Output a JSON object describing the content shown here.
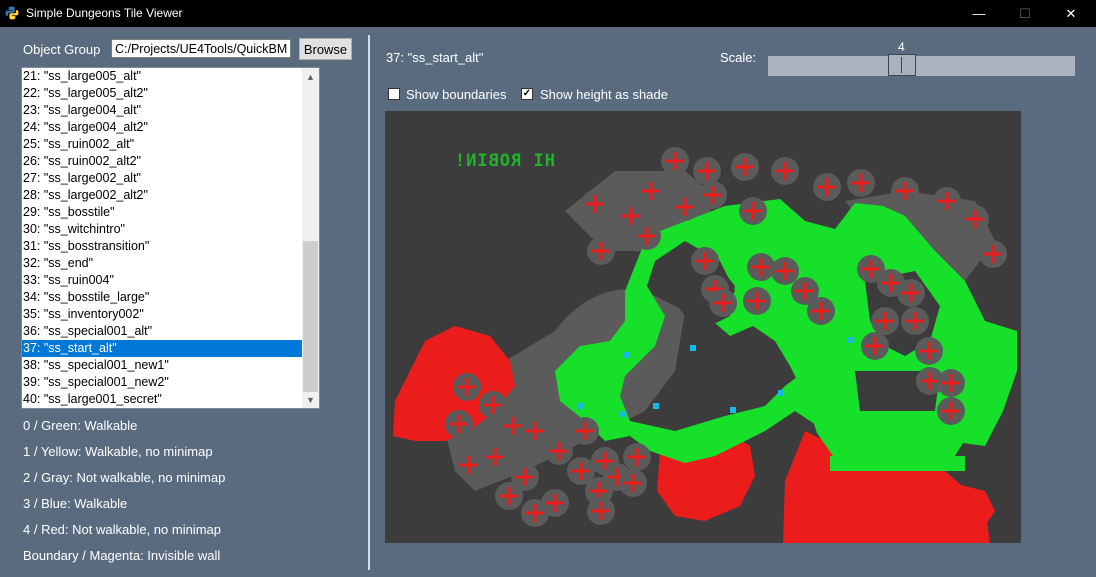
{
  "window": {
    "title": "Simple Dungeons Tile Viewer",
    "minimize_glyph": "—",
    "maximize_glyph": "☐",
    "close_glyph": "✕"
  },
  "object_group": {
    "label": "Object Group",
    "path_value": "C:/Projects/UE4Tools/QuickBMS",
    "browse_label": "Browse"
  },
  "tile_list": {
    "items": [
      "21: \"ss_large005_alt\"",
      "22: \"ss_large005_alt2\"",
      "23: \"ss_large004_alt\"",
      "24: \"ss_large004_alt2\"",
      "25: \"ss_ruin002_alt\"",
      "26: \"ss_ruin002_alt2\"",
      "27: \"ss_large002_alt\"",
      "28: \"ss_large002_alt2\"",
      "29: \"ss_bosstile\"",
      "30: \"ss_witchintro\"",
      "31: \"ss_bosstransition\"",
      "32: \"ss_end\"",
      "33: \"ss_ruin004\"",
      "34: \"ss_bosstile_large\"",
      "35: \"ss_inventory002\"",
      "36: \"ss_special001_alt\"",
      "37: \"ss_start_alt\"",
      "38: \"ss_special001_new1\"",
      "39: \"ss_special001_new2\"",
      "40: \"ss_large001_secret\""
    ],
    "selected_index": 16,
    "scroll_up_glyph": "▲",
    "scroll_down_glyph": "▼"
  },
  "legend": [
    "0 / Green: Walkable",
    "1 / Yellow: Walkable, no minimap",
    "2 / Gray: Not walkable, no minimap",
    "3 / Blue: Walkable",
    "4 / Red: Not walkable, no minimap",
    "Boundary / Magenta: Invisible wall"
  ],
  "viewer": {
    "selected_title": "37: \"ss_start_alt\"",
    "scale_label": "Scale:",
    "scale_value": "4",
    "show_boundaries_label": "Show boundaries",
    "show_boundaries_checked": false,
    "show_height_label": "Show height as shade",
    "show_height_checked": true,
    "check_glyph": "✓",
    "tile_text": "HI ROBIN!",
    "tile_text_mirrored": true
  },
  "colors": {
    "window_bg": "#5a6b80",
    "titlebar_bg": "#000000",
    "selection": "#0078d7",
    "preview_bg": "#3c3c3c",
    "walkable_green": "#17e02b",
    "not_walkable_red": "#ea1c1c",
    "gray_zone": "#5b5b5b",
    "blue_walkable": "#19b9e6",
    "text_green": "#1eb529"
  },
  "icons": {
    "app": "python-logo-icon",
    "scroll_up": "scroll-up-arrow-icon",
    "scroll_down": "scroll-down-arrow-icon",
    "check": "checkmark-icon",
    "markers": "red-cross-marker-icon"
  }
}
